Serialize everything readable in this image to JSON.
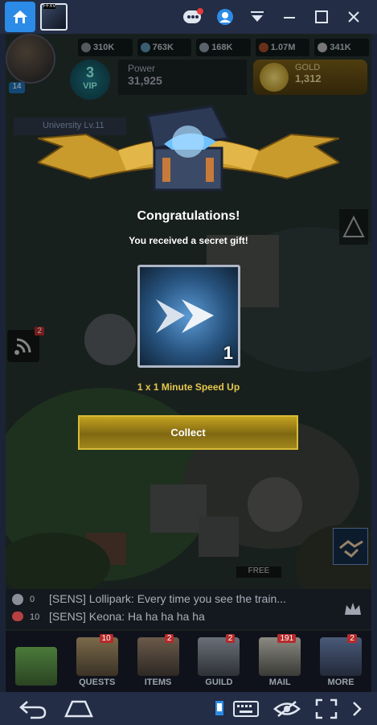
{
  "emulator": {
    "thumbnail_tag": "FFXV"
  },
  "resources": [
    {
      "icon": "food-icon",
      "value": "310K"
    },
    {
      "icon": "wood-icon",
      "value": "763K"
    },
    {
      "icon": "stone-icon",
      "value": "168K"
    },
    {
      "icon": "iron-icon",
      "value": "1.07M"
    },
    {
      "icon": "silver-icon",
      "value": "341K"
    }
  ],
  "player": {
    "level": "14",
    "vip_label": "VIP",
    "vip_level": "3",
    "power_label": "Power",
    "power_value": "31,925",
    "gold_label": "GOLD",
    "gold_value": "1,312",
    "research": "University Lv.11"
  },
  "popup": {
    "title": "Congratulations!",
    "subtitle": "You received a secret gift!",
    "item_count": "1",
    "item_name": "1 x 1 Minute Speed Up",
    "collect_label": "Collect"
  },
  "side": {
    "wifi_badge": "2",
    "free_label": "FREE"
  },
  "chat": {
    "lines": [
      {
        "count": "0",
        "text": "[SENS] Lollipark: Every time you see the train..."
      },
      {
        "count": "10",
        "text": "[SENS] Keona: Ha ha ha ha ha"
      }
    ]
  },
  "nav": [
    {
      "label": "",
      "badge": ""
    },
    {
      "label": "QUESTS",
      "badge": "10"
    },
    {
      "label": "ITEMS",
      "badge": "2"
    },
    {
      "label": "GUILD",
      "badge": "2"
    },
    {
      "label": "MAIL",
      "badge": "191"
    },
    {
      "label": "MORE",
      "badge": "2"
    }
  ],
  "colors": {
    "accent_gold": "#c2a21f",
    "item_name_yellow": "#e6c84c",
    "emulator_bar": "#232d45",
    "badge_red": "#b72a2a"
  }
}
